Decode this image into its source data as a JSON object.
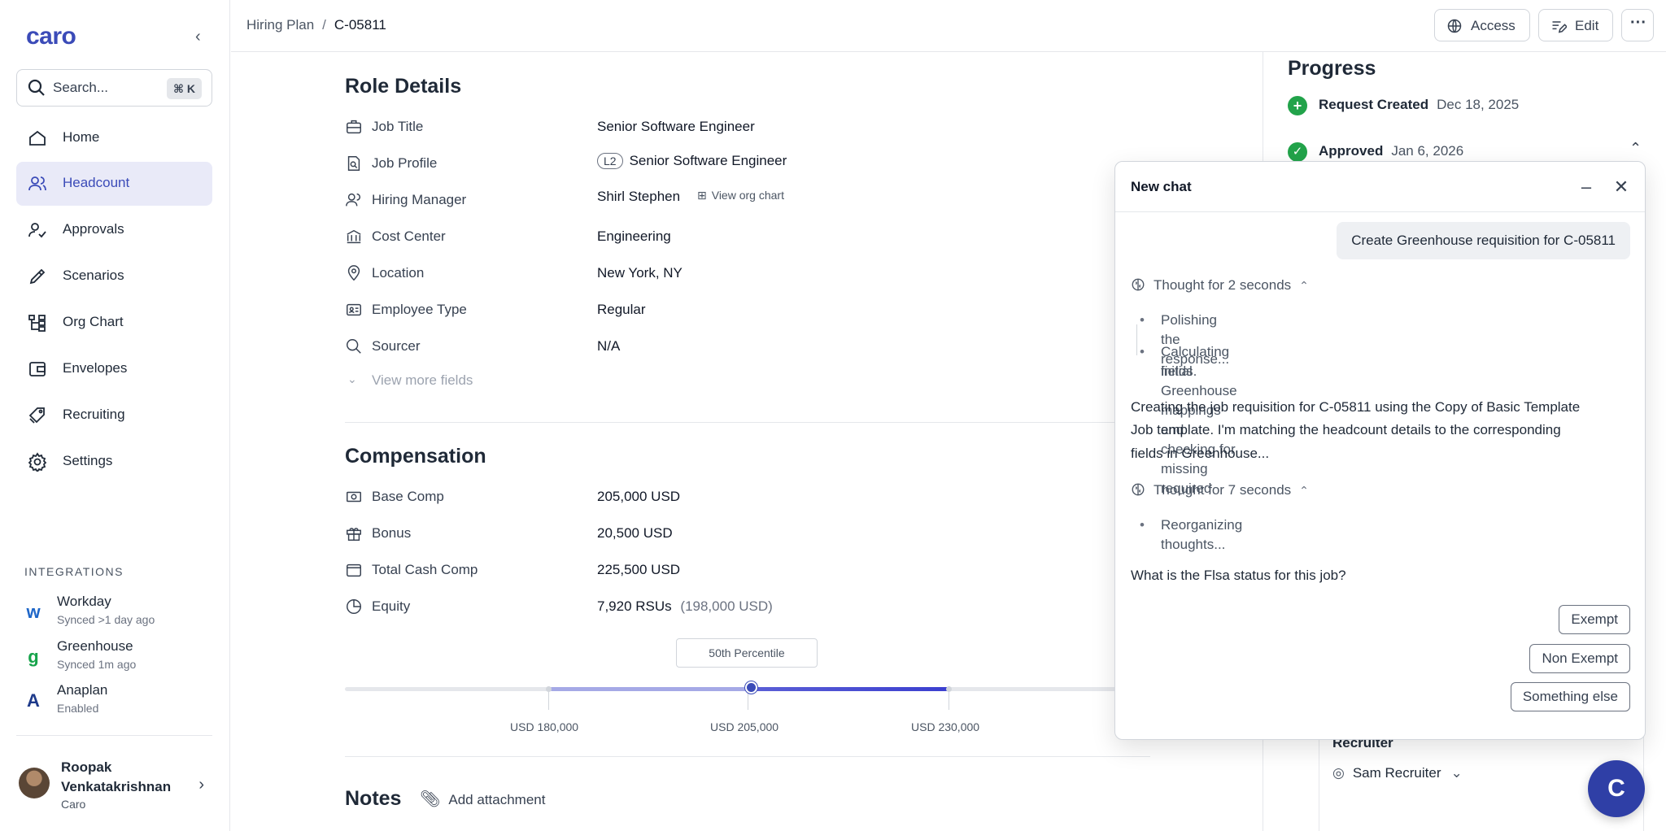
{
  "sidebar": {
    "logo": "caro",
    "search": {
      "placeholder": "Search...",
      "shortcut": "⌘ K"
    },
    "nav": [
      {
        "label": "Home",
        "icon": "home-icon"
      },
      {
        "label": "Headcount",
        "icon": "users-icon",
        "active": true
      },
      {
        "label": "Approvals",
        "icon": "approvals-icon"
      },
      {
        "label": "Scenarios",
        "icon": "pen-icon"
      },
      {
        "label": "Org Chart",
        "icon": "org-chart-icon"
      },
      {
        "label": "Envelopes",
        "icon": "wallet-icon"
      },
      {
        "label": "Recruiting",
        "icon": "tags-icon"
      },
      {
        "label": "Settings",
        "icon": "gear-icon"
      }
    ],
    "integrations_title": "INTEGRATIONS",
    "integrations": [
      {
        "name": "Workday",
        "status": "Synced >1 day ago",
        "color": "#f59e0b"
      },
      {
        "name": "Greenhouse",
        "status": "Synced 1m ago",
        "color": "#16a34a"
      },
      {
        "name": "Anaplan",
        "status": "Enabled",
        "color": "#1e3a8a"
      }
    ],
    "user": {
      "name": "Roopak Venkatakrishnan",
      "org": "Caro"
    }
  },
  "topbar": {
    "breadcrumb": [
      "Hiring Plan",
      "C-05811"
    ],
    "access_label": "Access",
    "edit_label": "Edit"
  },
  "role_details": {
    "title": "Role Details",
    "fields": [
      {
        "label": "Job Title",
        "value": "Senior Software Engineer"
      },
      {
        "label": "Job Profile",
        "badge": "L2",
        "value": "Senior Software Engineer"
      },
      {
        "label": "Hiring Manager",
        "value": "Shirl Stephen",
        "link": "View org chart"
      },
      {
        "label": "Cost Center",
        "value": "Engineering"
      },
      {
        "label": "Location",
        "value": "New York, NY"
      },
      {
        "label": "Employee Type",
        "value": "Regular"
      },
      {
        "label": "Sourcer",
        "value": "N/A"
      }
    ],
    "more": "View more fields"
  },
  "compensation": {
    "title": "Compensation",
    "fields": [
      {
        "label": "Base Comp",
        "value": "205,000 USD"
      },
      {
        "label": "Bonus",
        "value": "20,500 USD"
      },
      {
        "label": "Total Cash Comp",
        "value": "225,500 USD"
      },
      {
        "label": "Equity",
        "value": "7,920 RSUs",
        "extra": "(198,000 USD)"
      }
    ],
    "percentile": "50th Percentile",
    "ticks": [
      "USD 180,000",
      "USD 205,000",
      "USD 230,000"
    ],
    "colors": {
      "fill_start": "#a5a9e6",
      "fill_end": "#3b3fcf",
      "handle": "#3b4bb8"
    }
  },
  "notes": {
    "title": "Notes",
    "add_attachment": "Add attachment"
  },
  "progress": {
    "title": "Progress",
    "steps": [
      {
        "title": "Request Created",
        "date": "Dec 18, 2025",
        "icon": "plus-circle-icon"
      },
      {
        "title": "Approved",
        "date": "Jan 6, 2026",
        "icon": "check-circle-icon"
      }
    ],
    "recruiter_label": "Recruiter",
    "recruiter_value": "Sam Recruiter"
  },
  "chat": {
    "title": "New chat",
    "user_message": "Create Greenhouse requisition for C-05811",
    "thought1": {
      "label": "Thought for 2 seconds",
      "items": [
        "Polishing the response...",
        "Calculating initial Greenhouse mappings and checking for missing required",
        "fields."
      ]
    },
    "message": [
      "Creating the job requisition for C-05811 using the Copy of Basic Template",
      "Job template. I'm matching the headcount details to the corresponding",
      "fields in Greenhouse..."
    ],
    "thought2": {
      "label": "Thought for 7 seconds",
      "items": [
        "Reorganizing thoughts..."
      ]
    },
    "question": "What is the Flsa status for this job?",
    "options": [
      "Exempt",
      "Non Exempt",
      "Something else"
    ]
  },
  "fab_label": "C"
}
